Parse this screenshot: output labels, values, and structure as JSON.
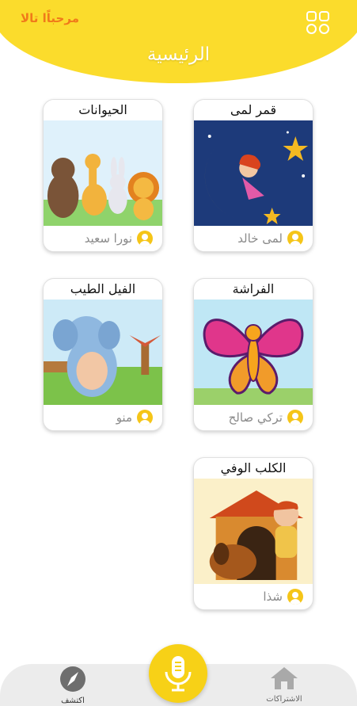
{
  "header": {
    "greeting": "مرحباًا تالا",
    "title": "الرئيسية",
    "menu_icon": "grid-icon"
  },
  "colors": {
    "header_yellow": "#fbdc2c",
    "greeting_orange": "#f07a1a",
    "mic_yellow": "#f7d117",
    "avatar_yellow": "#f5c518"
  },
  "stories": [
    {
      "title": "قمر لمى",
      "author": "لمى خالد"
    },
    {
      "title": "الحيوانات",
      "author": "نورا سعيد"
    },
    {
      "title": "الفراشة",
      "author": "تركي صالح"
    },
    {
      "title": "الفيل الطيب",
      "author": "منو"
    },
    {
      "title": "الكلب الوفي",
      "author": "شذا"
    }
  ],
  "bottom_nav": {
    "subscriptions_label": "الاشتراكات",
    "explore_label": "اكتشف",
    "subscriptions_icon": "home-icon",
    "explore_icon": "compass-icon",
    "mic_icon": "microphone-icon"
  }
}
